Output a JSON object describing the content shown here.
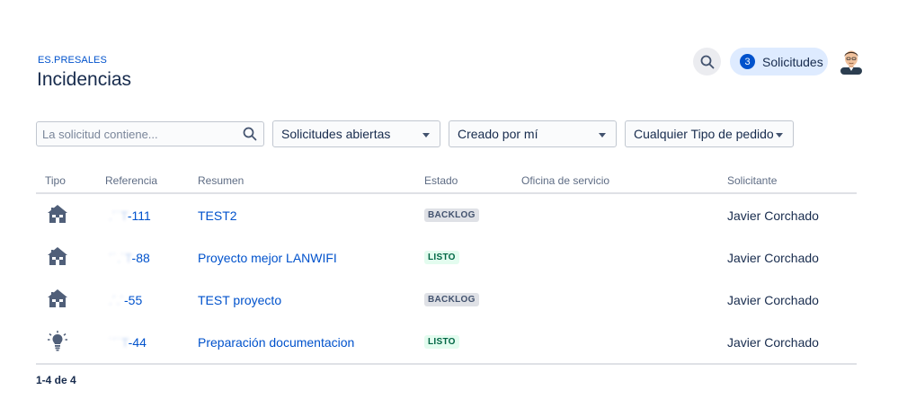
{
  "header": {
    "breadcrumb": "ES.PRESALES",
    "title": "Incidencias",
    "requests_count": "3",
    "requests_label": "Solicitudes"
  },
  "filters": {
    "search_placeholder": "La solicitud contiene...",
    "search_value": "",
    "status_filter": "Solicitudes abiertas",
    "creator_filter": "Creado por mí",
    "type_filter": "Cualquier Tipo de pedido"
  },
  "table": {
    "columns": [
      "Tipo",
      "Referencia",
      "Resumen",
      "Estado",
      "Oficina de servicio",
      "Solicitante"
    ],
    "rows": [
      {
        "type_icon": "house-icon",
        "ref_hidden": " .´˙T",
        "ref_visible": "-111",
        "summary": "TEST2",
        "status": "BACKLOG",
        "office": "",
        "requester": "Javier Corchado"
      },
      {
        "type_icon": "house-icon",
        "ref_hidden": " ´˙.˙T",
        "ref_visible": "-88",
        "summary": "Proyecto mejor LANWIFI",
        "status": "LISTO",
        "office": "",
        "requester": "Javier Corchado"
      },
      {
        "type_icon": "house-icon",
        "ref_hidden": " .´.´",
        "ref_visible": "-55",
        "summary": "TEST proyecto",
        "status": "BACKLOG",
        "office": "",
        "requester": "Javier Corchado"
      },
      {
        "type_icon": "lightbulb-icon",
        "ref_hidden": " ˙´˙T",
        "ref_visible": "-44",
        "summary": "Preparación documentacion",
        "status": "LISTO",
        "office": "",
        "requester": "Javier Corchado"
      }
    ]
  },
  "pagination": "1-4 de 4",
  "colors": {
    "accent": "#0052cc",
    "pill_bg": "#deebff",
    "backlog_bg": "#dfe1e6",
    "listo_bg": "#e3fcef",
    "listo_text": "#006644"
  }
}
